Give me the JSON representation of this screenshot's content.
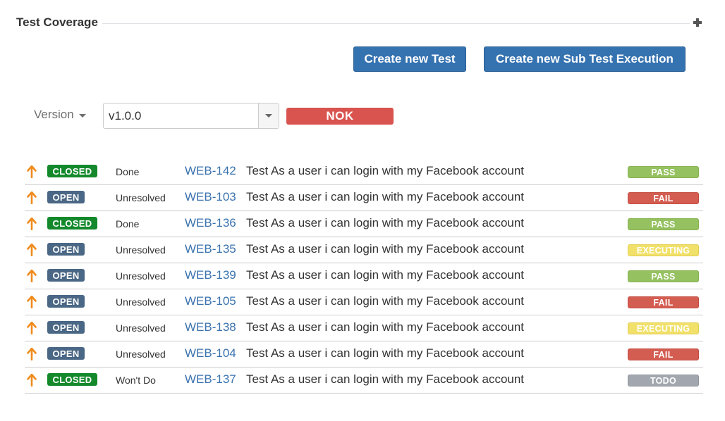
{
  "section": {
    "title": "Test Coverage",
    "toggle_icon": "plus-icon"
  },
  "buttons": {
    "create_test": "Create new Test",
    "create_sub_test_execution": "Create new Sub Test Execution"
  },
  "version": {
    "label": "Version",
    "selected": "v1.0.0",
    "overall_status": "NOK"
  },
  "colors": {
    "accent": "#3572b0",
    "link": "#3b73af",
    "closed": "#14892c",
    "open": "#4a6785",
    "pass": "#95c160",
    "fail": "#d45d52",
    "executing": "#f1e069",
    "todo": "#a2a6ae",
    "nok": "#d9534f",
    "priority": "#f08c1e"
  },
  "tests": [
    {
      "priority_icon": "priority-up-arrow-icon",
      "status": "CLOSED",
      "resolution": "Done",
      "key": "WEB-142",
      "summary": "Test As a user i can login with my Facebook account",
      "result": "PASS"
    },
    {
      "priority_icon": "priority-up-arrow-icon",
      "status": "OPEN",
      "resolution": "Unresolved",
      "key": "WEB-103",
      "summary": "Test As a user i can login with my Facebook account",
      "result": "FAIL"
    },
    {
      "priority_icon": "priority-up-arrow-icon",
      "status": "CLOSED",
      "resolution": "Done",
      "key": "WEB-136",
      "summary": "Test As a user i can login with my Facebook account",
      "result": "PASS"
    },
    {
      "priority_icon": "priority-up-arrow-icon",
      "status": "OPEN",
      "resolution": "Unresolved",
      "key": "WEB-135",
      "summary": "Test As a user i can login with my Facebook account",
      "result": "EXECUTING"
    },
    {
      "priority_icon": "priority-up-arrow-icon",
      "status": "OPEN",
      "resolution": "Unresolved",
      "key": "WEB-139",
      "summary": "Test As a user i can login with my Facebook account",
      "result": "PASS"
    },
    {
      "priority_icon": "priority-up-arrow-icon",
      "status": "OPEN",
      "resolution": "Unresolved",
      "key": "WEB-105",
      "summary": "Test As a user i can login with my Facebook account",
      "result": "FAIL"
    },
    {
      "priority_icon": "priority-up-arrow-icon",
      "status": "OPEN",
      "resolution": "Unresolved",
      "key": "WEB-138",
      "summary": "Test As a user i can login with my Facebook account",
      "result": "EXECUTING"
    },
    {
      "priority_icon": "priority-up-arrow-icon",
      "status": "OPEN",
      "resolution": "Unresolved",
      "key": "WEB-104",
      "summary": "Test As a user i can login with my Facebook account",
      "result": "FAIL"
    },
    {
      "priority_icon": "priority-up-arrow-icon",
      "status": "CLOSED",
      "resolution": "Won't Do",
      "key": "WEB-137",
      "summary": "Test As a user i can login with my Facebook account",
      "result": "TODO"
    }
  ]
}
